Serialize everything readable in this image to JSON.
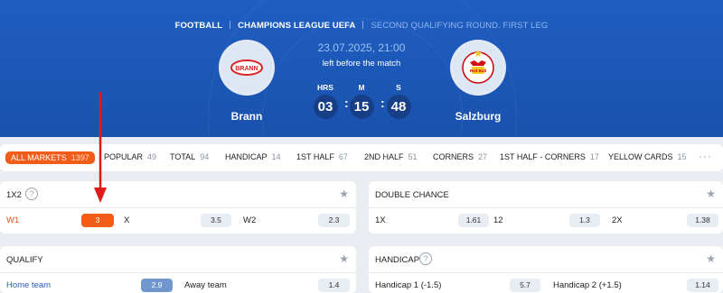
{
  "breadcrumbs": [
    "FOOTBALL",
    "CHAMPIONS LEAGUE UEFA",
    "SECOND QUALIFYING ROUND. FIRST LEG"
  ],
  "match": {
    "datetime": "23.07.2025, 21:00",
    "left_before": "left before the match",
    "home": {
      "name": "Brann",
      "logo_text": "BRANN"
    },
    "away": {
      "name": "Salzburg",
      "logo_text": "Red Bull"
    }
  },
  "countdown": {
    "hours_label": "HRS",
    "hours": "03",
    "minutes_label": "M",
    "minutes": "15",
    "seconds_label": "S",
    "seconds": "48"
  },
  "tabs": [
    {
      "label": "ALL MARKETS",
      "count": "1397",
      "active": true
    },
    {
      "label": "POPULAR",
      "count": "49"
    },
    {
      "label": "TOTAL",
      "count": "94"
    },
    {
      "label": "HANDICAP",
      "count": "14"
    },
    {
      "label": "1ST HALF",
      "count": "67"
    },
    {
      "label": "2ND HALF",
      "count": "51"
    },
    {
      "label": "CORNERS",
      "count": "27"
    },
    {
      "label": "1ST HALF - CORNERS",
      "count": "17"
    },
    {
      "label": "YELLOW CARDS",
      "count": "15"
    }
  ],
  "more_label": "···",
  "markets": {
    "m1x2": {
      "title": "1X2",
      "outcomes": [
        {
          "label": "W1",
          "value": "3"
        },
        {
          "label": "X",
          "value": "3.5"
        },
        {
          "label": "W2",
          "value": "2.3"
        }
      ]
    },
    "double_chance": {
      "title": "DOUBLE CHANCE",
      "outcomes": [
        {
          "label": "1X",
          "value": "1.61"
        },
        {
          "label": "12",
          "value": "1.3"
        },
        {
          "label": "2X",
          "value": "1.38"
        }
      ]
    },
    "qualify": {
      "title": "QUALIFY",
      "outcomes": [
        {
          "label": "Home team",
          "value": "2.9"
        },
        {
          "label": "Away team",
          "value": "1.4"
        }
      ]
    },
    "handicap": {
      "title": "HANDICAP",
      "outcomes": [
        {
          "label": "Handicap 1 (-1.5)",
          "value": "5.7"
        },
        {
          "label": "Handicap 2 (+1.5)",
          "value": "1.14"
        }
      ]
    }
  },
  "icons": {
    "help": "?",
    "star": "★"
  },
  "colors": {
    "header_blue": "#1f5ec2",
    "accent_orange": "#f25c19",
    "arrow_red": "#e0191a"
  }
}
